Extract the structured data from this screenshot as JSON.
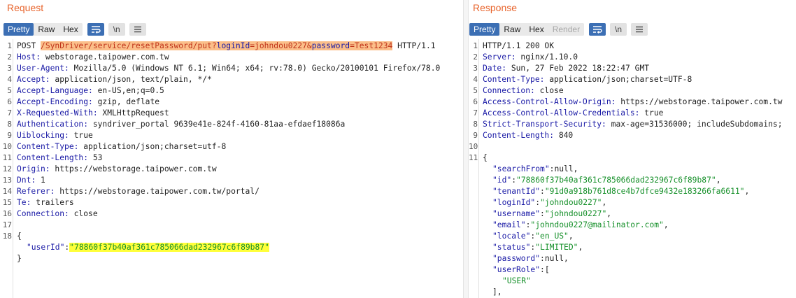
{
  "request": {
    "title": "Request",
    "view_tabs": [
      "Pretty",
      "Raw",
      "Hex"
    ],
    "icons": [
      "list-format-icon",
      "newline-icon",
      "menu-icon"
    ],
    "line_numbers": [
      "1",
      "2",
      "3",
      "4",
      "5",
      "6",
      "7",
      "8",
      "9",
      "10",
      "11",
      "12",
      "13",
      "14",
      "15",
      "16",
      "17",
      "18"
    ],
    "request_line": {
      "method": "POST ",
      "path": "/SynDriver/service/resetPassword/put?",
      "param1_name": "loginId",
      "param1_value": "=johndou0227&",
      "param2_name": "password",
      "param2_value": "=Test1234",
      "protocol": " HTTP/1.1"
    },
    "headers": [
      {
        "name": "Host:",
        "value": " webstorage.taipower.com.tw"
      },
      {
        "name": "User-Agent:",
        "value": " Mozilla/5.0 (Windows NT 6.1; Win64; x64; rv:78.0) Gecko/20100101 Firefox/78.0"
      },
      {
        "name": "Accept:",
        "value": " application/json, text/plain, */*"
      },
      {
        "name": "Accept-Language:",
        "value": " en-US,en;q=0.5"
      },
      {
        "name": "Accept-Encoding:",
        "value": " gzip, deflate"
      },
      {
        "name": "X-Requested-With:",
        "value": " XMLHttpRequest"
      },
      {
        "name": "Authentication:",
        "value": " syndriver_portal 9639e41e-824f-4160-81aa-efdaef18086a"
      },
      {
        "name": "Uiblocking:",
        "value": " true"
      },
      {
        "name": "Content-Type:",
        "value": " application/json;charset=utf-8"
      },
      {
        "name": "Content-Length:",
        "value": " 53"
      },
      {
        "name": "Origin:",
        "value": " https://webstorage.taipower.com.tw"
      },
      {
        "name": "Dnt:",
        "value": " 1"
      },
      {
        "name": "Referer:",
        "value": " https://webstorage.taipower.com.tw/portal/"
      },
      {
        "name": "Te:",
        "value": " trailers"
      },
      {
        "name": "Connection:",
        "value": " close"
      }
    ],
    "body": {
      "open": "{",
      "key": "\"userId\"",
      "colon": ":",
      "value": "\"78860f37b40af361c785066dad232967c6f89b87\"",
      "close": "}"
    }
  },
  "response": {
    "title": "Response",
    "view_tabs": [
      "Pretty",
      "Raw",
      "Hex",
      "Render"
    ],
    "icons": [
      "list-format-icon",
      "newline-icon",
      "menu-icon"
    ],
    "line_numbers": [
      "1",
      "2",
      "3",
      "4",
      "5",
      "6",
      "7",
      "8",
      "9",
      "10",
      "11"
    ],
    "status_line": "HTTP/1.1 200 OK",
    "headers": [
      {
        "name": "Server:",
        "value": " nginx/1.10.0"
      },
      {
        "name": "Date:",
        "value": " Sun, 27 Feb 2022 18:22:47 GMT"
      },
      {
        "name": "Content-Type:",
        "value": " application/json;charset=UTF-8"
      },
      {
        "name": "Connection:",
        "value": " close"
      },
      {
        "name": "Access-Control-Allow-Origin:",
        "value": " https://webstorage.taipower.com.tw"
      },
      {
        "name": "Access-Control-Allow-Credentials:",
        "value": " true"
      },
      {
        "name": "Strict-Transport-Security:",
        "value": " max-age=31536000; includeSubdomains;"
      },
      {
        "name": "Content-Length:",
        "value": " 840"
      }
    ],
    "body_open": "{",
    "body_fields": [
      {
        "key": "\"searchFrom\"",
        "sep": ":",
        "value": "null",
        "end": ",",
        "kind": "plain"
      },
      {
        "key": "\"id\"",
        "sep": ":",
        "value": "\"78860f37b40af361c785066dad232967c6f89b87\"",
        "end": ",",
        "kind": "str"
      },
      {
        "key": "\"tenantId\"",
        "sep": ":",
        "value": "\"91d0a918b761d8ce4b7dfce9432e183266fa6611\"",
        "end": ",",
        "kind": "str"
      },
      {
        "key": "\"loginId\"",
        "sep": ":",
        "value": "\"johndou0227\"",
        "end": ",",
        "kind": "str"
      },
      {
        "key": "\"username\"",
        "sep": ":",
        "value": "\"johndou0227\"",
        "end": ",",
        "kind": "str"
      },
      {
        "key": "\"email\"",
        "sep": ":",
        "value": "\"johndou0227@mailinator.com\"",
        "end": ",",
        "kind": "str"
      },
      {
        "key": "\"locale\"",
        "sep": ":",
        "value": "\"en_US\"",
        "end": ",",
        "kind": "str"
      },
      {
        "key": "\"status\"",
        "sep": ":",
        "value": "\"LIMITED\"",
        "end": ",",
        "kind": "str"
      },
      {
        "key": "\"password\"",
        "sep": ":",
        "value": "null",
        "end": ",",
        "kind": "plain"
      },
      {
        "key": "\"userRole\"",
        "sep": ":",
        "value": "[",
        "end": "",
        "kind": "plain"
      }
    ],
    "role_value": "\"USER\"",
    "role_close": "],"
  }
}
